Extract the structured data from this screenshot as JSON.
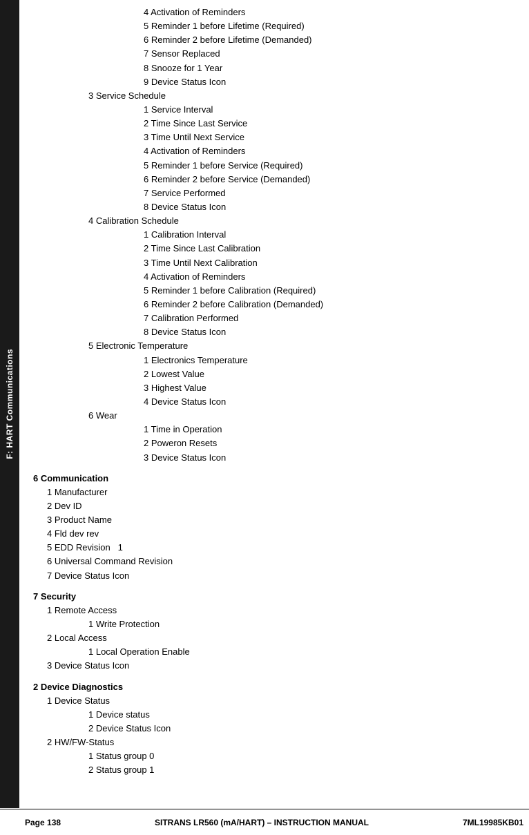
{
  "sidebar": {
    "label": "F: HART Communications"
  },
  "content": {
    "lines": [
      {
        "indent": 3,
        "text": "4 Activation of Reminders",
        "bold": false
      },
      {
        "indent": 3,
        "text": "5 Reminder 1 before Lifetime (Required)",
        "bold": false
      },
      {
        "indent": 3,
        "text": "6 Reminder 2 before Lifetime (Demanded)",
        "bold": false
      },
      {
        "indent": 3,
        "text": "7 Sensor Replaced",
        "bold": false
      },
      {
        "indent": 3,
        "text": "8 Snooze for 1 Year",
        "bold": false
      },
      {
        "indent": 3,
        "text": "9 Device Status Icon",
        "bold": false
      },
      {
        "indent": 2,
        "text": "3 Service Schedule",
        "bold": false
      },
      {
        "indent": 3,
        "text": "1 Service Interval",
        "bold": false
      },
      {
        "indent": 3,
        "text": "2 Time Since Last Service",
        "bold": false
      },
      {
        "indent": 3,
        "text": "3 Time Until Next Service",
        "bold": false
      },
      {
        "indent": 3,
        "text": "4 Activation of Reminders",
        "bold": false
      },
      {
        "indent": 3,
        "text": "5 Reminder 1 before Service (Required)",
        "bold": false
      },
      {
        "indent": 3,
        "text": "6 Reminder 2 before Service (Demanded)",
        "bold": false
      },
      {
        "indent": 3,
        "text": "7 Service Performed",
        "bold": false
      },
      {
        "indent": 3,
        "text": "8 Device Status Icon",
        "bold": false
      },
      {
        "indent": 2,
        "text": "4 Calibration Schedule",
        "bold": false
      },
      {
        "indent": 3,
        "text": "1 Calibration Interval",
        "bold": false
      },
      {
        "indent": 3,
        "text": "2 Time Since Last Calibration",
        "bold": false
      },
      {
        "indent": 3,
        "text": "3 Time Until Next Calibration",
        "bold": false
      },
      {
        "indent": 3,
        "text": "4 Activation of Reminders",
        "bold": false
      },
      {
        "indent": 3,
        "text": "5 Reminder 1 before Calibration (Required)",
        "bold": false
      },
      {
        "indent": 3,
        "text": "6 Reminder 2 before Calibration (Demanded)",
        "bold": false
      },
      {
        "indent": 3,
        "text": "7 Calibration Performed",
        "bold": false
      },
      {
        "indent": 3,
        "text": "8 Device Status Icon",
        "bold": false
      },
      {
        "indent": 2,
        "text": "5 Electronic Temperature",
        "bold": false
      },
      {
        "indent": 3,
        "text": "1 Electronics Temperature",
        "bold": false
      },
      {
        "indent": 3,
        "text": "2 Lowest Value",
        "bold": false
      },
      {
        "indent": 3,
        "text": "3 Highest Value",
        "bold": false
      },
      {
        "indent": 3,
        "text": "4 Device Status Icon",
        "bold": false
      },
      {
        "indent": 2,
        "text": "6 Wear",
        "bold": false
      },
      {
        "indent": 3,
        "text": "1 Time in Operation",
        "bold": false
      },
      {
        "indent": 3,
        "text": "2 Poweron Resets",
        "bold": false
      },
      {
        "indent": 3,
        "text": "3 Device Status Icon",
        "bold": false
      }
    ],
    "sections": [
      {
        "spacer": true,
        "label": "6 Communication",
        "bold": true,
        "indent": 0,
        "children": [
          {
            "indent": 1,
            "text": "1 Manufacturer"
          },
          {
            "indent": 1,
            "text": "2 Dev ID"
          },
          {
            "indent": 1,
            "text": "3 Product Name"
          },
          {
            "indent": 1,
            "text": "4 Fld dev rev"
          },
          {
            "indent": 1,
            "text": "5 EDD Revision   1"
          },
          {
            "indent": 1,
            "text": "6 Universal Command Revision"
          },
          {
            "indent": 1,
            "text": "7 Device Status Icon"
          }
        ]
      },
      {
        "spacer": true,
        "label": "7 Security",
        "bold": true,
        "indent": 0,
        "children": [
          {
            "indent": 1,
            "text": "1 Remote Access"
          },
          {
            "indent": 2,
            "text": "1 Write Protection"
          },
          {
            "indent": 1,
            "text": "2 Local Access"
          },
          {
            "indent": 2,
            "text": "1 Local Operation Enable"
          },
          {
            "indent": 1,
            "text": "3 Device Status Icon"
          }
        ]
      },
      {
        "spacer": true,
        "label": "2 Device Diagnostics",
        "bold": true,
        "indent": 0,
        "children": [
          {
            "indent": 1,
            "text": "1 Device Status"
          },
          {
            "indent": 2,
            "text": "1 Device status"
          },
          {
            "indent": 2,
            "text": "2 Device Status Icon"
          },
          {
            "indent": 1,
            "text": "2 HW/FW-Status"
          },
          {
            "indent": 2,
            "text": "1 Status group 0"
          },
          {
            "indent": 2,
            "text": "2 Status group 1"
          }
        ]
      }
    ]
  },
  "footer": {
    "left": "Page 138",
    "center": "SITRANS LR560 (mA/HART) – INSTRUCTION MANUAL",
    "right": "7ML19985KB01"
  }
}
